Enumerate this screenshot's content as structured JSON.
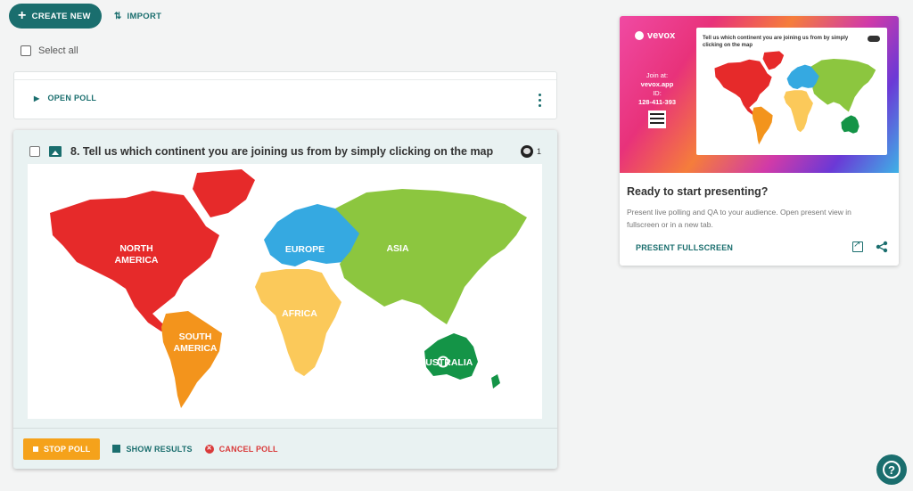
{
  "toolbar": {
    "create_label": "CREATE NEW",
    "import_label": "IMPORT"
  },
  "select_all_label": "Select all",
  "open_poll_card": {
    "open_label": "OPEN POLL"
  },
  "active_poll": {
    "title": "8. Tell us which continent you are joining us from by simply clicking on the map",
    "response_count": "1",
    "map_labels": {
      "north_america": [
        "NORTH",
        "AMERICA"
      ],
      "south_america": [
        "SOUTH",
        "AMERICA"
      ],
      "europe": "EUROPE",
      "africa": "AFRICA",
      "asia": "ASIA",
      "australia": "AUSTRALIA"
    },
    "actions": {
      "stop": "STOP POLL",
      "show_results": "SHOW RESULTS",
      "cancel": "CANCEL POLL"
    }
  },
  "present_panel": {
    "preview_logo": "vevox",
    "preview_join": "Join at:",
    "preview_url": "vevox.app",
    "preview_id_label": "ID:",
    "preview_id": "128-411-393",
    "preview_question": "Tell us which continent you are joining us from by simply clicking on the map",
    "heading": "Ready to start presenting?",
    "description": "Present live polling and QA to your audience. Open present view in fullscreen or in a new tab.",
    "present_link": "PRESENT FULLSCREEN"
  },
  "colors": {
    "teal": "#1a6e6e",
    "north_america": "#e62a2a",
    "south_america": "#f3941c",
    "europe": "#35a9e1",
    "africa": "#fbc95a",
    "asia": "#8cc63f",
    "australia": "#149447"
  }
}
